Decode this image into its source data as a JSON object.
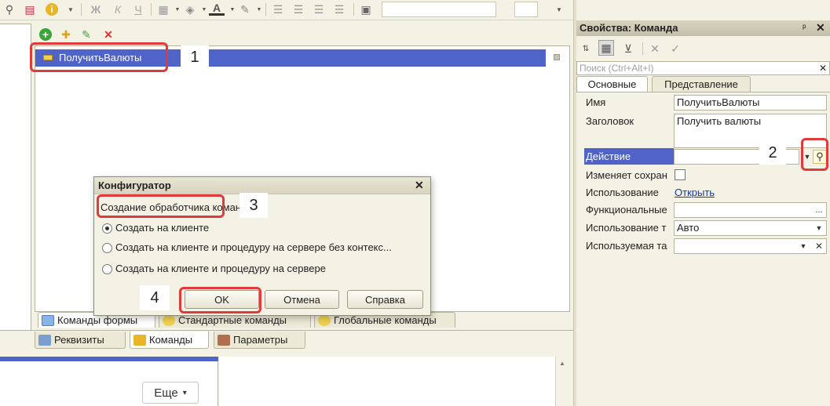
{
  "toolbar": {
    "icons": [
      "search-list-icon",
      "report-icon",
      "info-icon",
      "bold-icon",
      "italic-icon",
      "underline-icon",
      "borders-icon",
      "fill-color-icon",
      "font-color-icon",
      "highlight-icon",
      "align-left-icon",
      "align-center-icon",
      "align-right-icon",
      "align-justify-icon",
      "style-icon"
    ],
    "bold": "Ж",
    "italic": "К",
    "underline": "Ч",
    "font_color_letter": "A"
  },
  "commands_tree": {
    "selected_item": "ПолучитьВалюты"
  },
  "bottom_tabs_top": [
    "Команды формы",
    "Стандартные команды",
    "Глобальные команды"
  ],
  "bottom_tabs_bottom": [
    "Реквизиты",
    "Команды",
    "Параметры"
  ],
  "lower_pane": {
    "more_button": "Еще",
    "more_arrow": "▾"
  },
  "properties": {
    "title": "Свойства: Команда",
    "search_placeholder": "Поиск (Ctrl+Alt+I)",
    "tabs": [
      "Основные",
      "Представление"
    ],
    "rows": {
      "name_label": "Имя",
      "name_value": "ПолучитьВалюты",
      "caption_label": "Заголовок",
      "caption_value": "Получить валюты",
      "action_label": "Действие",
      "modifies_label": "Изменяет сохран",
      "usage_label": "Использование",
      "usage_link": "Открыть",
      "functional_label": "Функциональные",
      "usage2_label": "Использование т",
      "usage2_value": "Авто",
      "used_label": "Используемая та"
    },
    "ellipsis": "...",
    "close_glyph": "✕",
    "pin_glyph": "ᵖ"
  },
  "dialog": {
    "title": "Конфигуратор",
    "close_glyph": "✕",
    "heading": "Создание обработчика команды:",
    "options": [
      "Создать на клиенте",
      "Создать на клиенте и процедуру на сервере без контекс...",
      "Создать на клиенте и процедуру на сервере"
    ],
    "ok": "OK",
    "cancel": "Отмена",
    "help": "Справка"
  },
  "annotations": [
    "1",
    "2",
    "3",
    "4"
  ],
  "colors": {
    "selection": "#4f63c8",
    "highlight_red": "#e03a3a",
    "panel_bg": "#f4f2e4"
  }
}
